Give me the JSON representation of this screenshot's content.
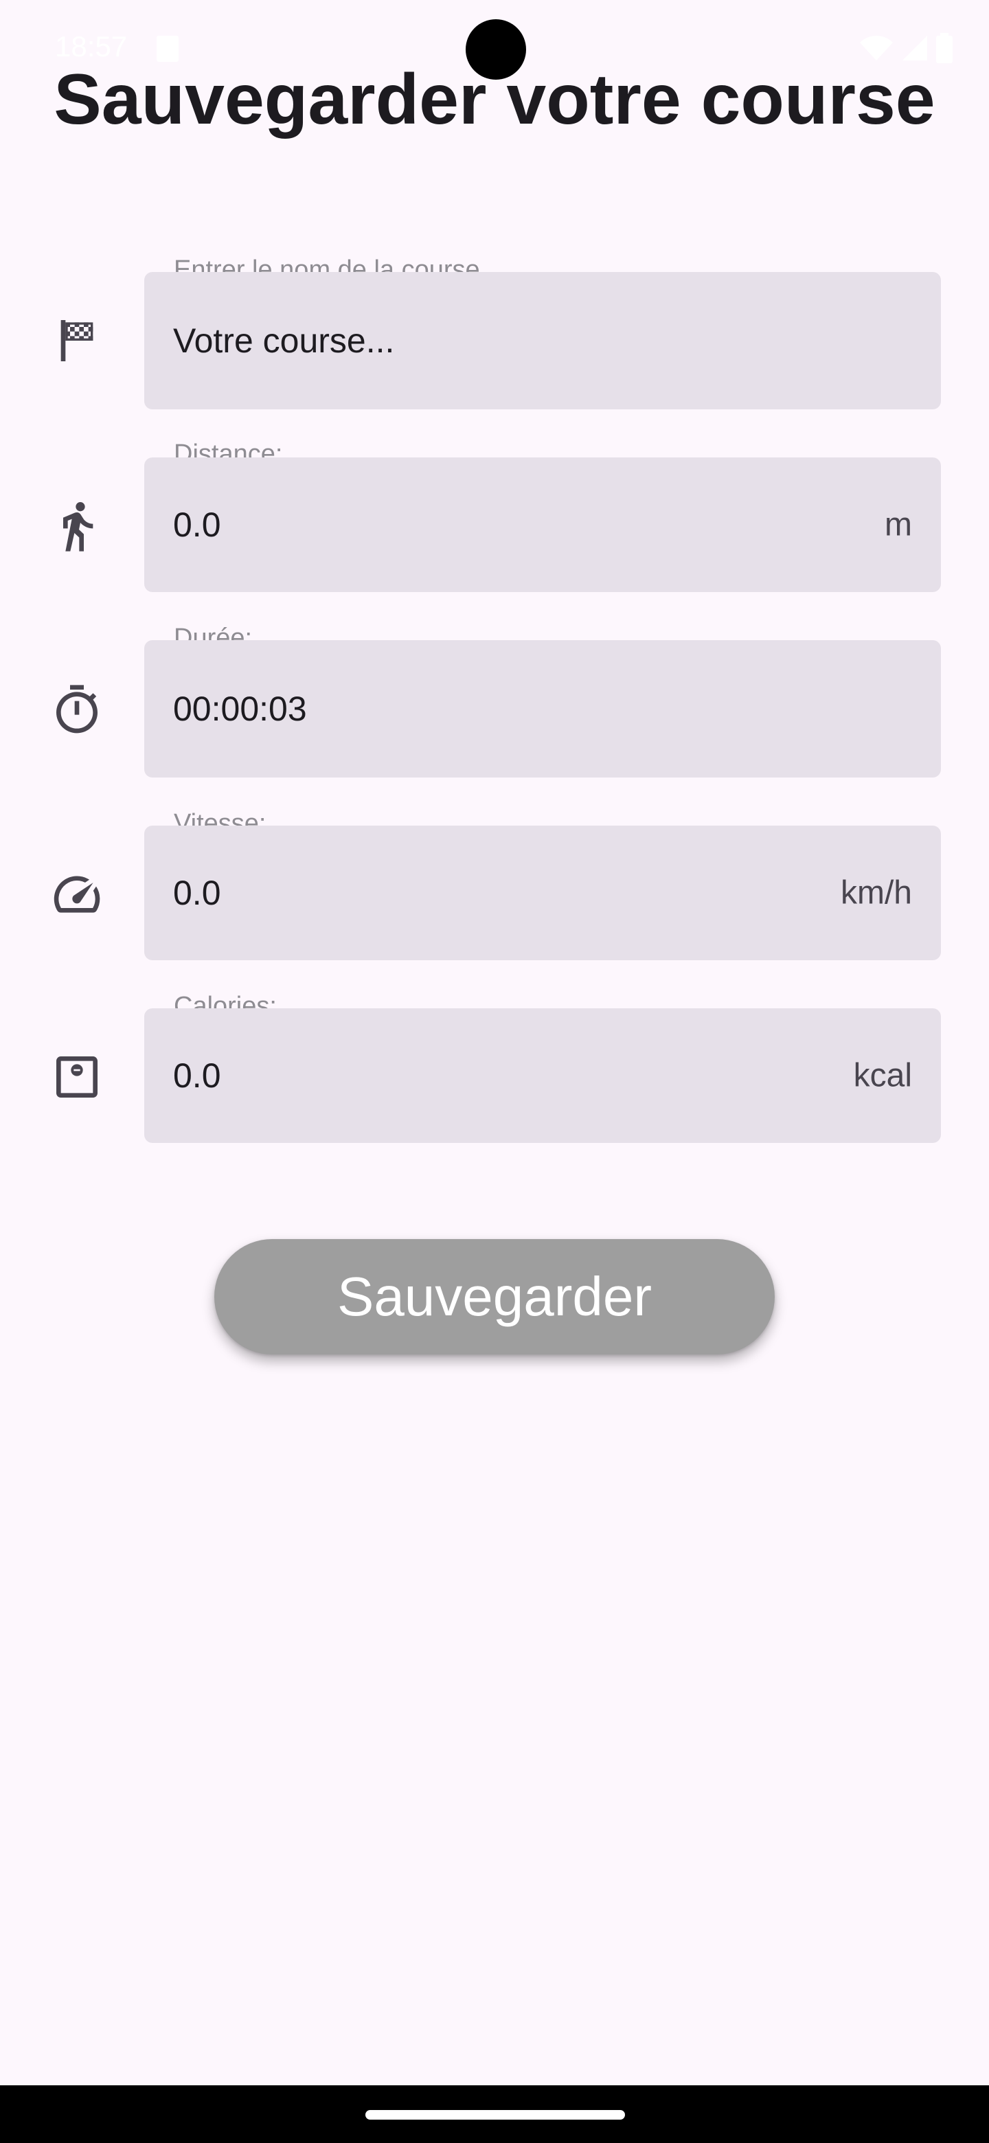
{
  "status_bar": {
    "time": "18:57"
  },
  "page": {
    "title": "Sauvegarder votre course"
  },
  "fields": [
    {
      "icon": "checkered-flag-icon",
      "label": "Entrer le nom de la course...",
      "value": "Votre course...",
      "suffix": ""
    },
    {
      "icon": "running-person-icon",
      "label": "Distance:",
      "value": "0.0",
      "suffix": "m"
    },
    {
      "icon": "stopwatch-icon",
      "label": "Durée:",
      "value": "00:00:03",
      "suffix": ""
    },
    {
      "icon": "speedometer-icon",
      "label": "Vitesse:",
      "value": "0.0",
      "suffix": "km/h"
    },
    {
      "icon": "scale-icon",
      "label": "Calories:",
      "value": "0.0",
      "suffix": "kcal"
    }
  ],
  "actions": {
    "save_label": "Sauvegarder"
  },
  "colors": {
    "background": "#fdf7fd",
    "field_fill": "#e6e0e9",
    "button_fill": "#9e9e9e",
    "title_text": "#1d1b20",
    "icon": "#49454f"
  }
}
